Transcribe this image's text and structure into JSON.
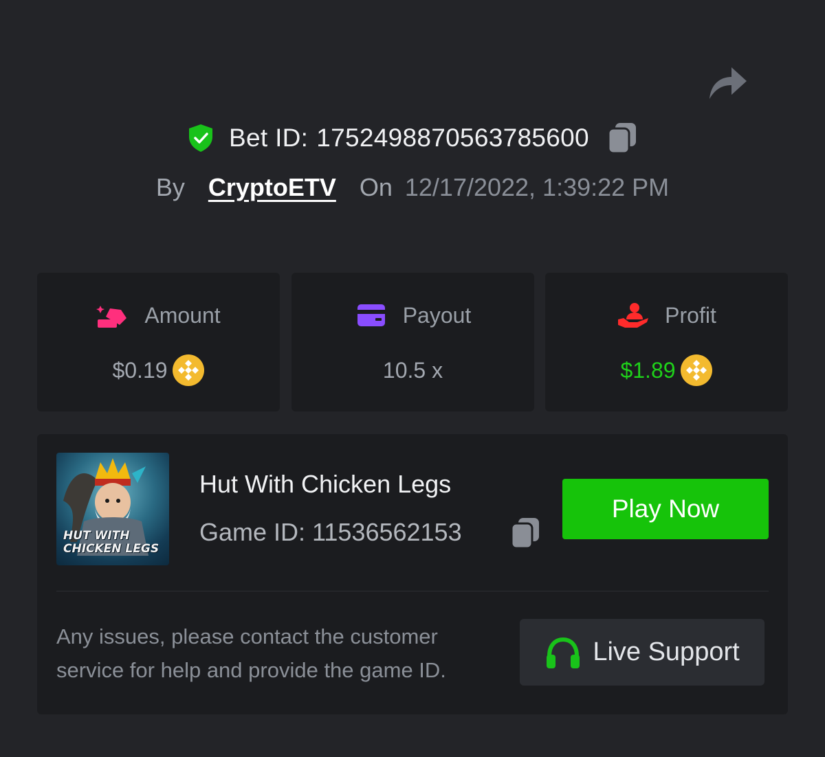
{
  "bet": {
    "id_label": "Bet ID:",
    "id_value": "1752498870563785600",
    "by_label": "By",
    "username": "CryptoETV",
    "on_label": "On",
    "datetime": "12/17/2022, 1:39:22 PM"
  },
  "stats": {
    "amount": {
      "label": "Amount",
      "value": "$0.19",
      "icon": "coins-hand-icon",
      "coin": "bnb-coin-icon"
    },
    "payout": {
      "label": "Payout",
      "value": "10.5 x",
      "icon": "card-icon"
    },
    "profit": {
      "label": "Profit",
      "value": "$1.89",
      "icon": "hand-person-icon",
      "coin": "bnb-coin-icon"
    }
  },
  "game": {
    "thumbnail_caption_line1": "HUT WITH",
    "thumbnail_caption_line2": "CHICKEN LEGS",
    "name": "Hut With Chicken Legs",
    "id_text": "Game ID: 11536562153",
    "play_label": "Play Now"
  },
  "support": {
    "notice": "Any issues, please contact the customer service for help and provide the game ID.",
    "button_label": "Live Support"
  },
  "colors": {
    "background": "#232428",
    "card": "#1b1c1f",
    "accent_green": "#16c30a",
    "profit_green": "#1fd11a",
    "shield_green": "#19c21a",
    "amount_pink": "#ff2f7d",
    "payout_purple": "#8a4dff",
    "profit_red": "#ff2b2b",
    "coin_yellow": "#f3ba2f"
  }
}
